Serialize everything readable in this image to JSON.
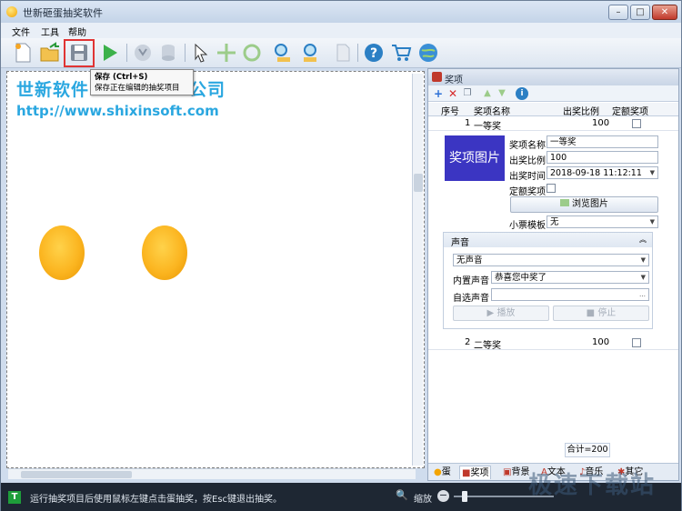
{
  "window": {
    "title": "世新砸蛋抽奖软件"
  },
  "menu": [
    "文件",
    "工具",
    "帮助"
  ],
  "tooltip": {
    "title": "保存 (Ctrl+S)",
    "desc": "保存正在编辑的抽奖项目"
  },
  "canvas": {
    "company": "世新软件",
    "company_tail": "公司",
    "url": "http://www.shixinsoft.com"
  },
  "panel": {
    "title": "奖项",
    "columns": [
      "序号",
      "奖项名称",
      "出奖比例",
      "定额奖项"
    ],
    "rows": [
      {
        "no": "1",
        "name": "一等奖",
        "ratio": "100"
      },
      {
        "no": "2",
        "name": "二等奖",
        "ratio": "100"
      }
    ],
    "detail": {
      "image_label": "奖项图片",
      "name_label": "奖项名称",
      "name_value": "一等奖",
      "ratio_label": "出奖比例",
      "ratio_value": "100",
      "time_label": "出奖时间",
      "time_value": "2018-09-18 11:12:11",
      "fixed_label": "定额奖项",
      "browse_button": "浏览图片",
      "ticket_label": "小票模板",
      "ticket_value": "无",
      "sound": {
        "title": "声音",
        "mode": "无声音",
        "builtin_label": "内置声音",
        "builtin_value": "恭喜您中奖了",
        "custom_label": "自选声音",
        "custom_value": "",
        "play_button": "播放",
        "stop_button": "停止"
      }
    },
    "total": "合计=200",
    "tabs": [
      "蛋",
      "奖项",
      "背景",
      "文本",
      "音乐",
      "其它"
    ],
    "active_tab": "奖项"
  },
  "statusbar": {
    "text": "运行抽奖项目后使用鼠标左键点击蛋抽奖，按Esc键退出抽奖。",
    "zoom_label": "缩放"
  },
  "watermark": "极速下载站"
}
